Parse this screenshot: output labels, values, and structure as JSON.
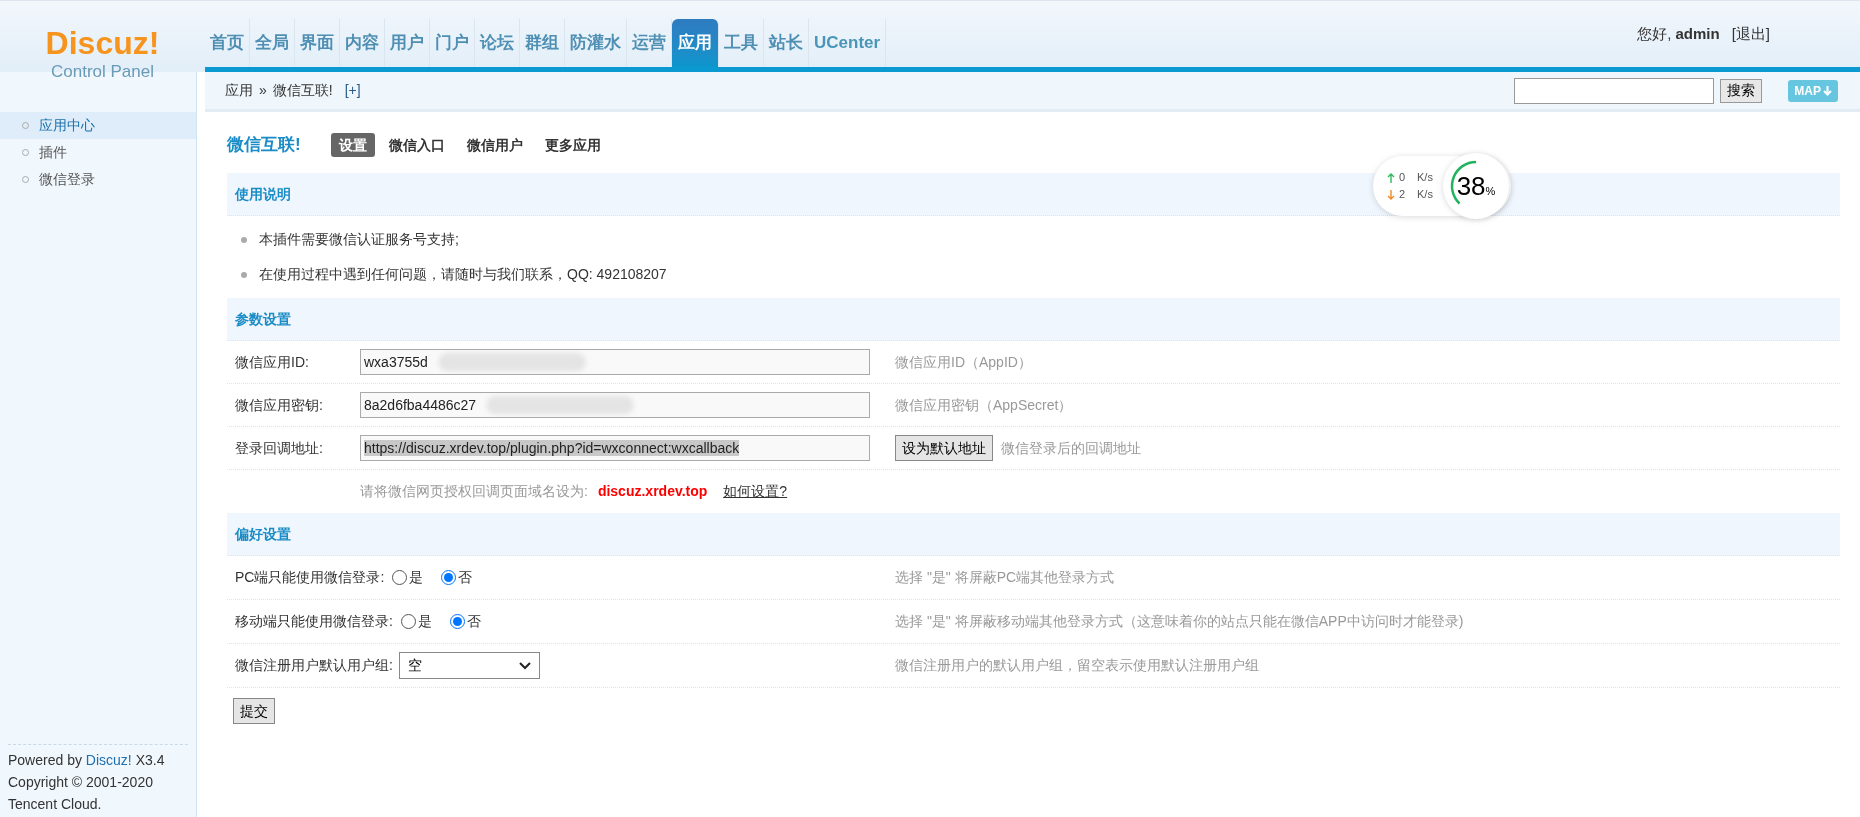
{
  "logo": {
    "title": "Discuz",
    "mark": "!",
    "subtitle": "Control Panel"
  },
  "nav": [
    {
      "label": "首页",
      "selected": false
    },
    {
      "label": "全局",
      "selected": false
    },
    {
      "label": "界面",
      "selected": false
    },
    {
      "label": "内容",
      "selected": false
    },
    {
      "label": "用户",
      "selected": false
    },
    {
      "label": "门户",
      "selected": false
    },
    {
      "label": "论坛",
      "selected": false
    },
    {
      "label": "群组",
      "selected": false
    },
    {
      "label": "防灌水",
      "selected": false
    },
    {
      "label": "运营",
      "selected": false
    },
    {
      "label": "应用",
      "selected": true
    },
    {
      "label": "工具",
      "selected": false
    },
    {
      "label": "站长",
      "selected": false
    },
    {
      "label": "UCenter",
      "selected": false
    }
  ],
  "user": {
    "greeting": "您好,",
    "name": "admin",
    "logout": "[退出]"
  },
  "breadcrumb": {
    "items": [
      "应用",
      "微信互联!"
    ],
    "separator": "»",
    "add": "[+]"
  },
  "search": {
    "button": "搜索"
  },
  "map_button": "MAP",
  "sidebar": {
    "items": [
      {
        "label": "应用中心",
        "selected": true
      },
      {
        "label": "插件",
        "selected": false
      },
      {
        "label": "微信登录",
        "selected": false
      }
    ],
    "footer": {
      "powered": "Powered by",
      "brand": "Discuz!",
      "version": "X3.4",
      "copyright": "Copyright © 2001-2020",
      "company": "Tencent Cloud."
    }
  },
  "page": {
    "title": "微信互联!",
    "tabs": [
      {
        "label": "设置",
        "selected": true
      },
      {
        "label": "微信入口",
        "selected": false
      },
      {
        "label": "微信用户",
        "selected": false
      },
      {
        "label": "更多应用",
        "selected": false
      }
    ]
  },
  "speed_widget": {
    "up": "0",
    "down": "2",
    "up_unit": "K/s",
    "down_unit": "K/s",
    "percent": "38",
    "percent_sign": "%",
    "level": 0.38
  },
  "sections": [
    {
      "title": "使用说明",
      "notes": [
        "本插件需要微信认证服务号支持;",
        "在使用过程中遇到任何问题，请随时与我们联系，QQ: 492108207"
      ]
    },
    {
      "title": "参数设置",
      "rows": [
        {
          "kind": "text",
          "label": "微信应用ID:",
          "value": "wxa3755d",
          "redacted": true,
          "description": "微信应用ID（AppID）"
        },
        {
          "kind": "text",
          "label": "微信应用密钥:",
          "value": "8a2d6fba4486c27",
          "redacted": true,
          "description": "微信应用密钥（AppSecret）"
        },
        {
          "kind": "url",
          "label": "登录回调地址:",
          "value": "https://discuz.xrdev.top/plugin.php?id=wxconnect:wxcallback",
          "highlighted": true,
          "button": "设为默认地址",
          "description": "微信登录后的回调地址"
        },
        {
          "kind": "hint",
          "text": "请将微信网页授权回调页面域名设为:",
          "domain": "discuz.xrdev.top",
          "link": "如何设置?"
        }
      ]
    },
    {
      "title": "偏好设置",
      "rows": [
        {
          "kind": "radio",
          "label": "PC端只能使用微信登录:",
          "options": [
            {
              "label": "是",
              "selected": false
            },
            {
              "label": "否",
              "selected": true
            }
          ],
          "description": "选择 \"是\" 将屏蔽PC端其他登录方式"
        },
        {
          "kind": "radio",
          "label": "移动端只能使用微信登录:",
          "options": [
            {
              "label": "是",
              "selected": false
            },
            {
              "label": "否",
              "selected": true
            }
          ],
          "description": "选择 \"是\" 将屏蔽移动端其他登录方式（这意味着你的站点只能在微信APP中访问时才能登录)"
        },
        {
          "kind": "select",
          "label": "微信注册用户默认用户组:",
          "value": "空",
          "description": "微信注册用户的默认用户组，留空表示使用默认注册用户组"
        }
      ]
    }
  ],
  "submit": "提交"
}
